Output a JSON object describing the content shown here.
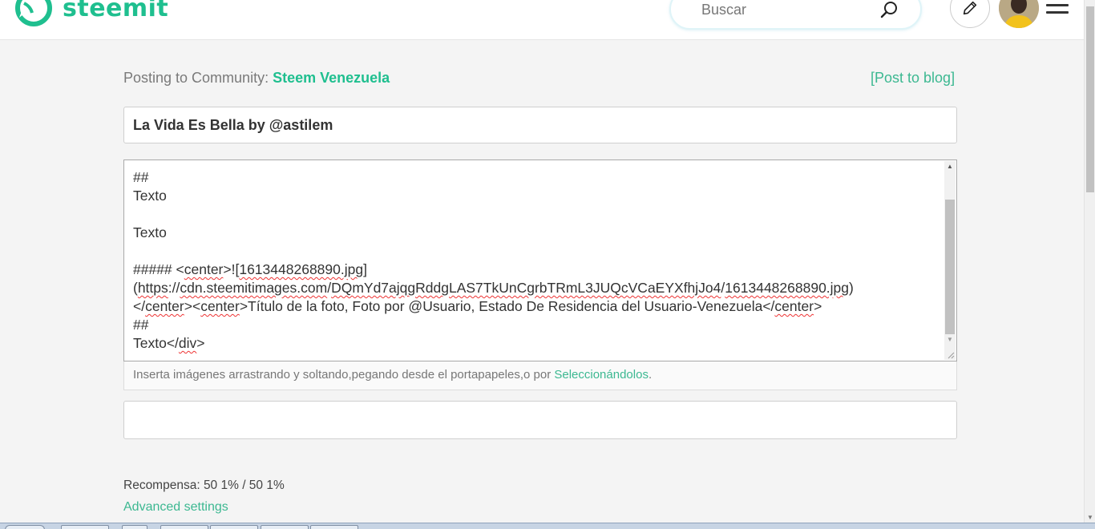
{
  "header": {
    "logo_text": "steemit",
    "brand_color": "#1fbf8f",
    "search_placeholder": "Buscar",
    "icons": [
      "steemit-logo-icon",
      "search-icon",
      "pencil-icon",
      "avatar",
      "hamburger-menu-icon"
    ]
  },
  "posting": {
    "prefix": "Posting to Community:",
    "community": "Steem Venezuela",
    "post_to_blog": "[Post to blog]"
  },
  "title_value": "La Vida Es Bella by @astilem",
  "editor": {
    "lines": {
      "l1": "##",
      "l2": "Texto",
      "l3": "Texto",
      "l4_a": "##### <",
      "l4_b": "center",
      "l4_c": ">![",
      "l4_d": "1613448268890.jpg",
      "l4_e": "]",
      "l5_a": "(",
      "l5_b": "https",
      "l5_c": "://",
      "l5_d": "cdn.steemitimages.com",
      "l5_e": "/",
      "l5_f": "DQmYd7ajqgRddgLAS7TkUnCgrbTRmL3JUQcVCaEYXfhjJo4",
      "l5_g": "/",
      "l5_h": "1613448268890.jpg",
      "l5_i": ")",
      "l6_a": "</",
      "l6_b": "center",
      "l6_c": "><",
      "l6_d": "center",
      "l6_e": ">Título de la foto, Foto por @Usuario, Estado De Residencia del Usuario-Venezuela</",
      "l6_f": "center",
      "l6_g": ">",
      "l7": "##",
      "l8_a": "Texto</",
      "l8_b": "div",
      "l8_c": ">"
    }
  },
  "drop_hint": {
    "text": "Inserta imágenes arrastrando y soltando,pegando desde el portapapeles,o por ",
    "link": "Seleccionándolos",
    "suffix": "."
  },
  "tags_value": "",
  "reward": "Recompensa: 50 1% / 50 1%",
  "advanced_settings": "Advanced settings"
}
